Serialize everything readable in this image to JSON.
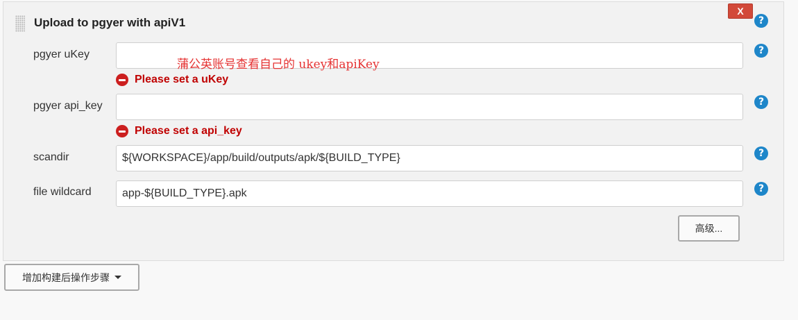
{
  "section": {
    "title": "Upload to pgyer with apiV1",
    "close_label": "X",
    "help_glyph": "?"
  },
  "annotation": "蒲公英账号查看自己的 ukey和apiKey",
  "fields": {
    "ukey": {
      "label": "pgyer uKey",
      "value": "",
      "error": "Please set a uKey"
    },
    "api_key": {
      "label": "pgyer api_key",
      "value": "",
      "error": "Please set a api_key"
    },
    "scandir": {
      "label": "scandir",
      "value": "${WORKSPACE}/app/build/outputs/apk/${BUILD_TYPE}"
    },
    "wildcard": {
      "label": "file wildcard",
      "value": "app-${BUILD_TYPE}.apk"
    }
  },
  "buttons": {
    "advanced": "高级...",
    "add_post_build_step": "增加构建后操作步骤"
  },
  "icons": {
    "help": "question-circle-icon",
    "error": "minus-circle-icon",
    "dropdown": "caret-down-icon",
    "drag": "drag-handle-icon"
  },
  "colors": {
    "help_blue": "#1e86c9",
    "close_red": "#d24939",
    "error_red": "#c00000",
    "annotation_red": "#e53333"
  }
}
